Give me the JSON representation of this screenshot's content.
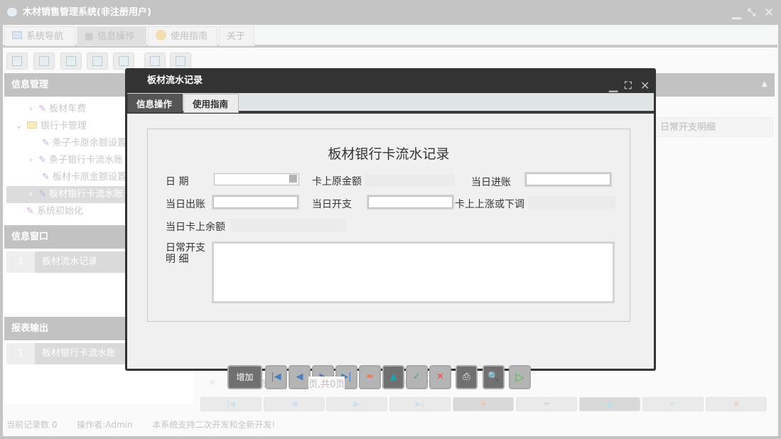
{
  "app": {
    "title": "木材销售管理系统(非注册用户)",
    "window_controls": [
      "minimize",
      "restore",
      "close"
    ]
  },
  "tabs": [
    {
      "label": "系统导航",
      "icon": "monitor-icon"
    },
    {
      "label": "信息操作",
      "icon": "grid-icon"
    },
    {
      "label": "使用指南",
      "icon": "help-icon"
    },
    {
      "label": "关于"
    }
  ],
  "toolbar_icons": [
    "search-icon",
    "list-icon",
    "document-icon",
    "users-icon",
    "screen-icon",
    "export-icon",
    "print-icon"
  ],
  "left": {
    "info_mgmt": {
      "title": "信息管理",
      "items": [
        {
          "label": "板材车费",
          "indent": 2,
          "arrow": "›"
        },
        {
          "label": "银行卡管理",
          "indent": 1,
          "arrow": "⌄",
          "folder": true
        },
        {
          "label": "条子卡原余额设置",
          "indent": 2
        },
        {
          "label": "条子银行卡流水账",
          "indent": 2,
          "arrow": "›"
        },
        {
          "label": "板材卡原金额设置",
          "indent": 2
        },
        {
          "label": "板材银行卡流水账",
          "indent": 2,
          "arrow": "›",
          "selected": true
        },
        {
          "label": "系统初始化",
          "indent": 1
        }
      ]
    },
    "info_window": {
      "title": "信息窗口",
      "rows": [
        {
          "num": "1",
          "label": "板材流水记录"
        }
      ]
    },
    "report": {
      "title": "报表输出",
      "rows": [
        {
          "num": "1",
          "label": "板材银行卡流水账"
        }
      ]
    }
  },
  "right": {
    "column_header": "日常开支明细",
    "pager": {
      "page_label": "第",
      "page_value": "0",
      "total_label": "页,共0页"
    }
  },
  "status": {
    "records": "当前记录数 0",
    "operator": "操作者:Admin",
    "note": "本系统支持二次开发和全新开发!"
  },
  "modal": {
    "title": "板材流水记录",
    "tabs": [
      "信息操作",
      "使用指南"
    ],
    "form_title": "板材银行卡流水记录",
    "fields": {
      "date": "日 期",
      "original_amount": "卡上原金额",
      "daily_income": "当日进账",
      "daily_out": "当日出账",
      "daily_expense": "当日开支",
      "adjust": "卡上上涨或下调",
      "balance": "当日卡上余额",
      "detail": "日常开支\n明 细"
    },
    "buttons": {
      "add": "增加"
    }
  }
}
